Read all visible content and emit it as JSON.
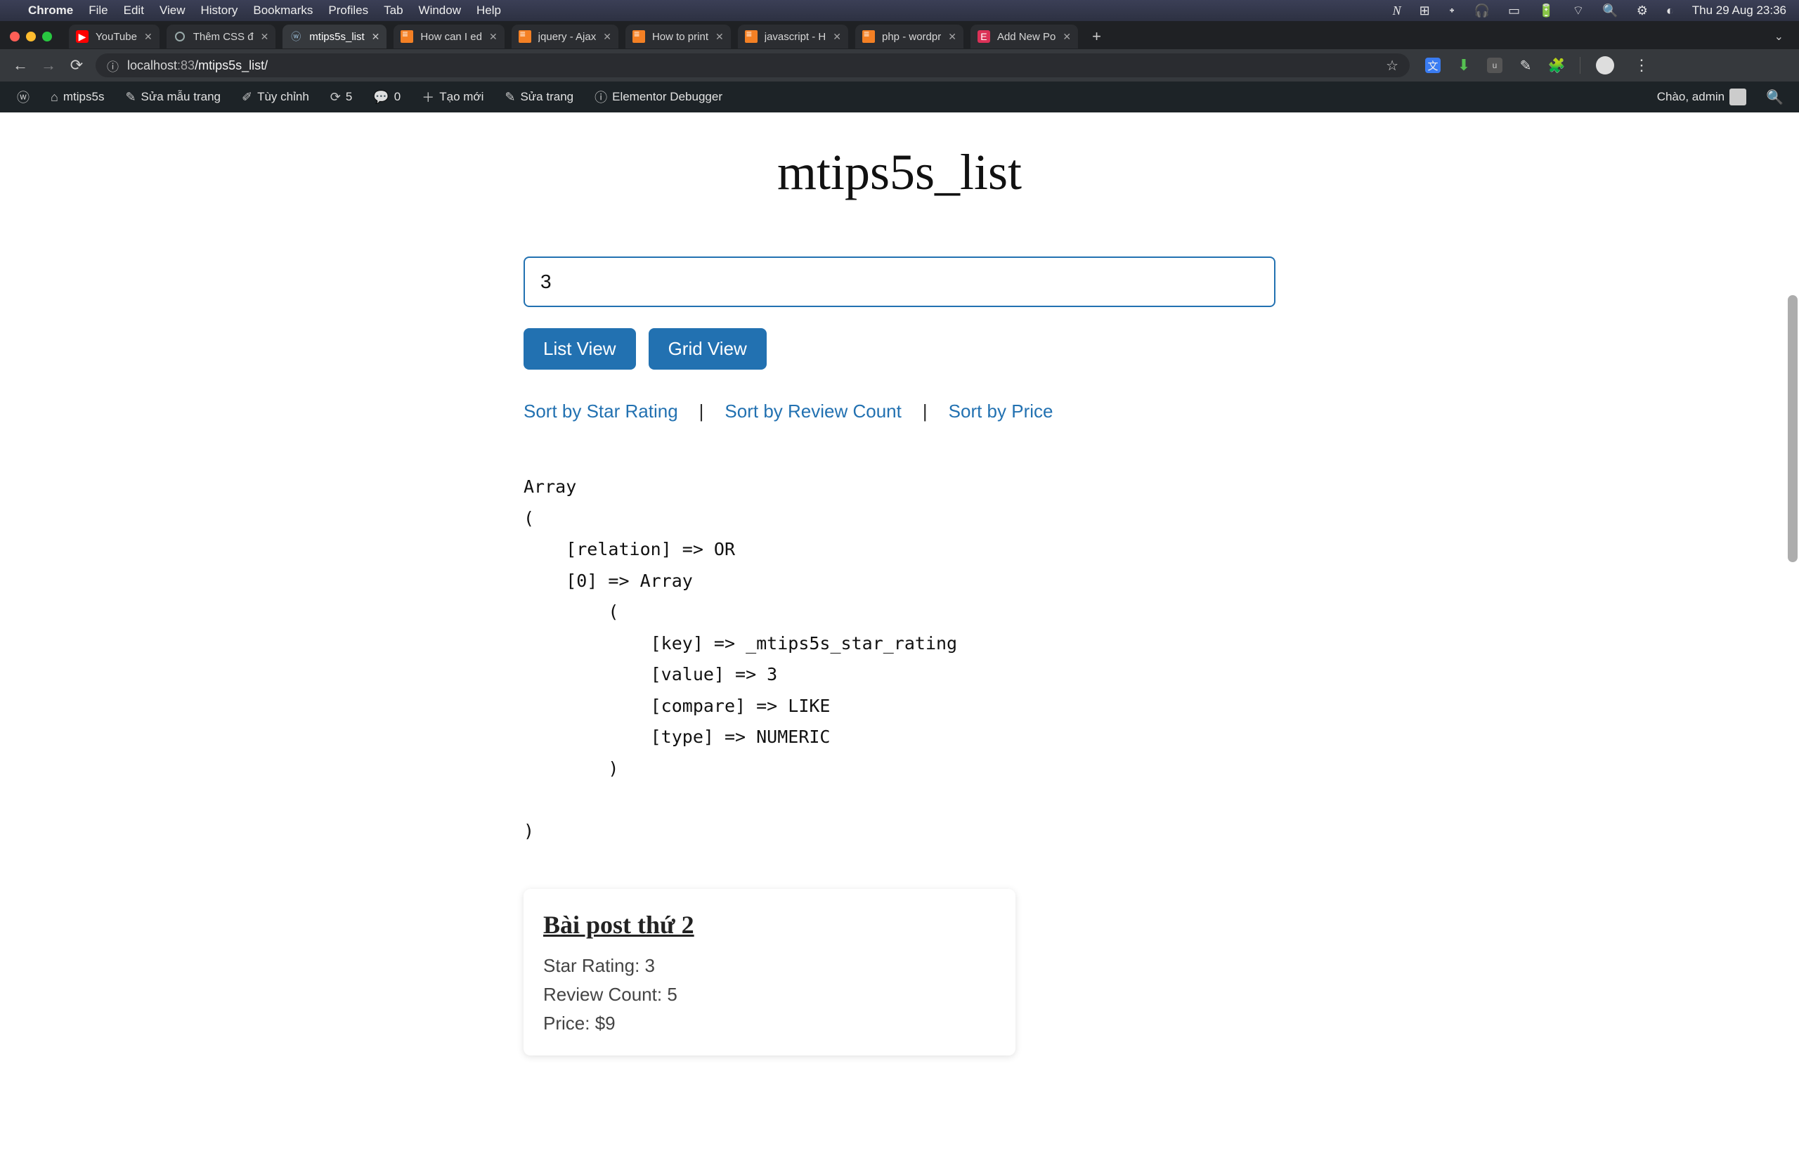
{
  "mac_menu": {
    "app": "Chrome",
    "items": [
      "File",
      "Edit",
      "View",
      "History",
      "Bookmarks",
      "Profiles",
      "Tab",
      "Window",
      "Help"
    ],
    "datetime": "Thu 29 Aug  23:36"
  },
  "tabs": [
    {
      "title": "YouTube",
      "favicon": "youtube"
    },
    {
      "title": "Thêm CSS đ",
      "favicon": "openai"
    },
    {
      "title": "mtips5s_list",
      "favicon": "wordpress",
      "active": true
    },
    {
      "title": "How can I ed",
      "favicon": "stackoverflow"
    },
    {
      "title": "jquery - Ajax",
      "favicon": "stackoverflow"
    },
    {
      "title": "How to print",
      "favicon": "stackoverflow"
    },
    {
      "title": "javascript - H",
      "favicon": "stackoverflow"
    },
    {
      "title": "php - wordpr",
      "favicon": "stackoverflow"
    },
    {
      "title": "Add New Po",
      "favicon": "elementor"
    }
  ],
  "omnibox": {
    "host": "localhost",
    "port": ":83",
    "path": "/mtips5s_list/"
  },
  "wp_bar": {
    "site": "mtips5s",
    "customize": "Sửa mẫu trang",
    "edit_live": "Tùy chỉnh",
    "rev_count": "5",
    "comment_count": "0",
    "add_new": "Tạo mới",
    "edit_page": "Sửa trang",
    "debugger": "Elementor Debugger",
    "greeting": "Chào, admin"
  },
  "page": {
    "title": "mtips5s_list",
    "search_value": "3",
    "buttons": {
      "list": "List View",
      "grid": "Grid View"
    },
    "sort": {
      "star": "Sort by Star Rating",
      "review": "Sort by Review Count",
      "price": "Sort by Price"
    },
    "dump": "Array\n(\n    [relation] => OR\n    [0] => Array\n        (\n            [key] => _mtips5s_star_rating\n            [value] => 3\n            [compare] => LIKE\n            [type] => NUMERIC\n        )\n\n)",
    "card": {
      "title": "Bài post thứ 2",
      "star_label": "Star Rating: ",
      "star_value": "3",
      "review_label": "Review Count: ",
      "review_value": "5",
      "price_label": "Price: ",
      "price_value": "$9"
    }
  }
}
